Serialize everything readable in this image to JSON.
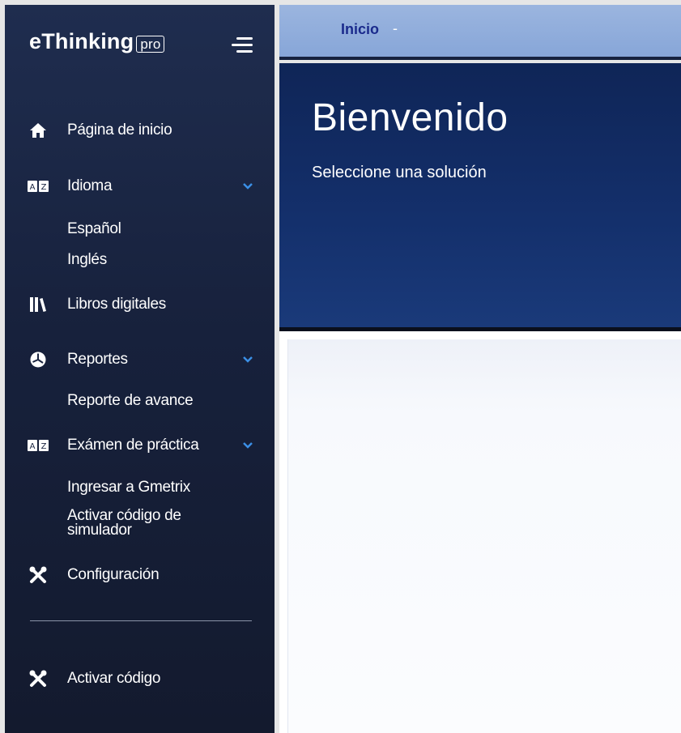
{
  "brand": {
    "name": "eThinking",
    "badge": "pro"
  },
  "sidebar": {
    "items": [
      {
        "label": "Página de inicio",
        "icon": "home-icon"
      },
      {
        "label": "Idioma",
        "icon": "language-icon",
        "expanded": true,
        "children": [
          "Español",
          "Inglés"
        ]
      },
      {
        "label": "Libros digitales",
        "icon": "books-icon"
      },
      {
        "label": "Reportes",
        "icon": "pie-chart-icon",
        "expanded": true,
        "children": [
          "Reporte de avance"
        ]
      },
      {
        "label": "Exámen de práctica",
        "icon": "language-icon",
        "expanded": true,
        "children": [
          "Ingresar a Gmetrix",
          "Activar código de simulador"
        ]
      },
      {
        "label": "Configuración",
        "icon": "tools-icon"
      },
      {
        "label": "Activar código",
        "icon": "tools-icon"
      }
    ]
  },
  "breadcrumb": {
    "items": [
      "Inicio"
    ],
    "separator": "-"
  },
  "hero": {
    "title": "Bienvenido",
    "subtitle": "Seleccione una solución"
  },
  "colors": {
    "sidebar": "#1a2440",
    "breadcrumb_bar": "#8fabdb",
    "hero": "#13306a",
    "crumb_text": "#1a2a8c"
  }
}
